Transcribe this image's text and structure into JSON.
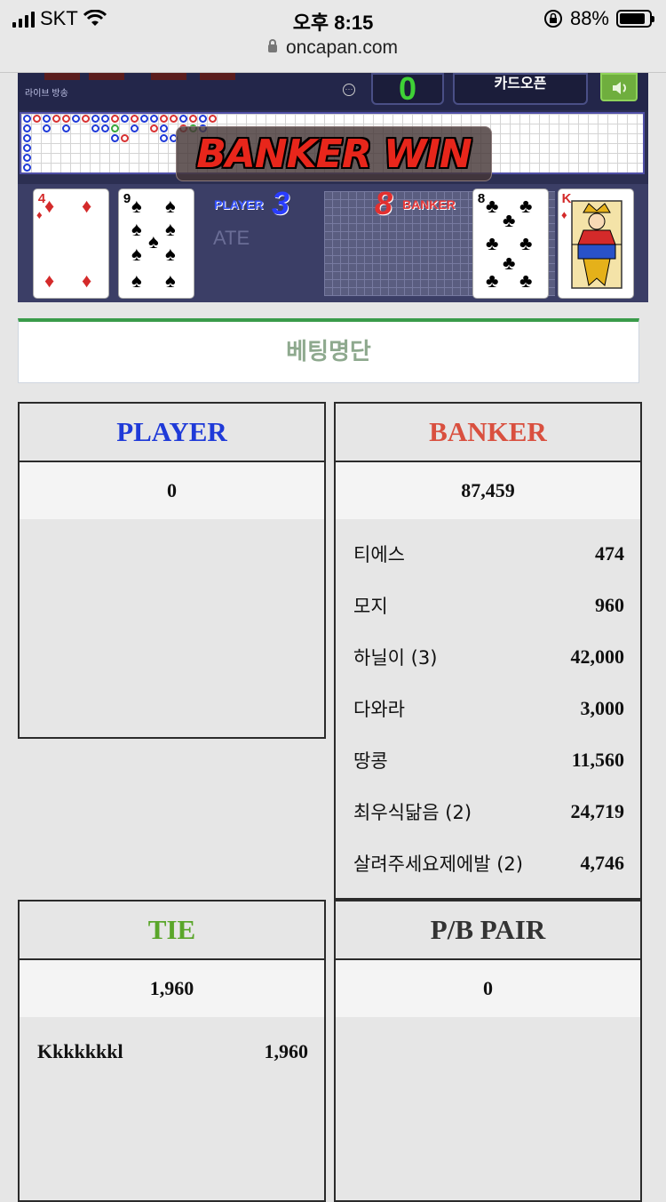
{
  "status_bar": {
    "carrier": "SKT",
    "time": "오후 8:15",
    "battery": "88%",
    "battery_level": 0.88
  },
  "browser": {
    "url": "oncapan.com"
  },
  "game": {
    "live_label": "라이브 방송",
    "counter": "0",
    "card_open_button": "카드오픈",
    "result_banner": "BANKER WIN",
    "watermark": "ATE",
    "player": {
      "label": "PLAYER",
      "score": "3",
      "cards": [
        {
          "rank": "4",
          "suit": "♦"
        },
        {
          "rank": "9",
          "suit": "♠"
        }
      ]
    },
    "banker": {
      "label": "BANKER",
      "score": "8",
      "cards": [
        {
          "rank": "8",
          "suit": "♣"
        },
        {
          "rank": "K",
          "suit": "♦"
        }
      ]
    }
  },
  "betting": {
    "title": "베팅명단",
    "player": {
      "label": "PLAYER",
      "color": "#1f3ad8",
      "total": "0",
      "bets": []
    },
    "banker": {
      "label": "BANKER",
      "color": "#d9503f",
      "total": "87,459",
      "bets": [
        {
          "name": "티에스",
          "amount": "474"
        },
        {
          "name": "모지",
          "amount": "960"
        },
        {
          "name": "하닐이 (3)",
          "amount": "42,000"
        },
        {
          "name": "다와라",
          "amount": "3,000"
        },
        {
          "name": "땅콩",
          "amount": "11,560"
        },
        {
          "name": "최우식닮음 (2)",
          "amount": "24,719"
        },
        {
          "name": "살려주세요제에발 (2)",
          "amount": "4,746"
        }
      ]
    },
    "tie": {
      "label": "TIE",
      "color": "#5aa62a",
      "total": "1,960",
      "bets": [
        {
          "name": "Kkkkkkkl",
          "amount": "1,960"
        }
      ]
    },
    "pair": {
      "label": "P/B PAIR",
      "color": "#333333",
      "total": "0",
      "bets": []
    }
  }
}
